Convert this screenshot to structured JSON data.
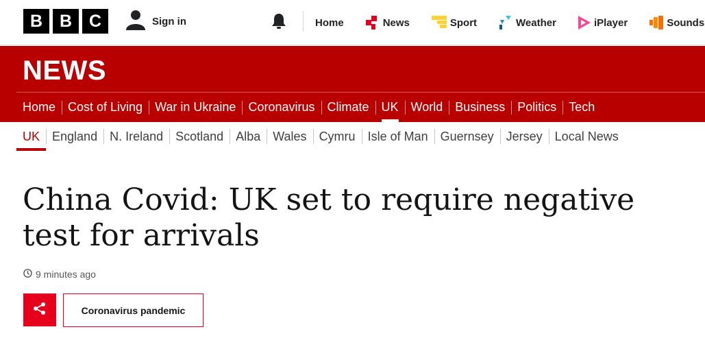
{
  "brand": {
    "letters": [
      "B",
      "B",
      "C"
    ]
  },
  "account": {
    "signin_label": "Sign in"
  },
  "top_nav": [
    {
      "label": "Home",
      "icon": "none"
    },
    {
      "label": "News",
      "icon": "news-icon",
      "color": "#e6001b"
    },
    {
      "label": "Sport",
      "icon": "sport-icon",
      "color": "#ffd230"
    },
    {
      "label": "Weather",
      "icon": "weather-icon",
      "color": "#1a8fd6"
    },
    {
      "label": "iPlayer",
      "icon": "iplayer-icon",
      "color": "#f54997"
    },
    {
      "label": "Sounds",
      "icon": "sounds-icon",
      "color": "#ff6d00"
    }
  ],
  "news_banner": {
    "title": "NEWS",
    "background": "#b80000",
    "sections": [
      "Home",
      "Cost of Living",
      "War in Ukraine",
      "Coronavirus",
      "Climate",
      "UK",
      "World",
      "Business",
      "Politics",
      "Tech"
    ],
    "active_section": "UK"
  },
  "sub_nav": {
    "items": [
      "UK",
      "England",
      "N. Ireland",
      "Scotland",
      "Alba",
      "Wales",
      "Cymru",
      "Isle of Man",
      "Guernsey",
      "Jersey",
      "Local News"
    ],
    "active": "UK"
  },
  "article": {
    "headline": "China Covid: UK set to require negative test for arrivals",
    "timestamp": "9 minutes ago",
    "topic_tag": "Coronavirus pandemic"
  }
}
